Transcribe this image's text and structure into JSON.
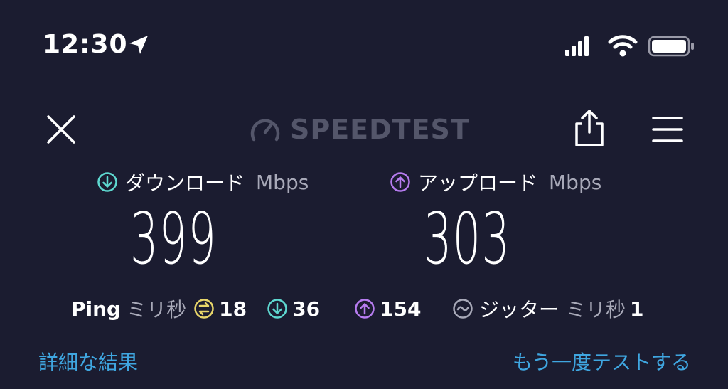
{
  "status_bar": {
    "time": "12:30"
  },
  "header": {
    "logo_text": "SPEEDTEST"
  },
  "download": {
    "label": "ダウンロード",
    "unit": "Mbps",
    "value": "399"
  },
  "upload": {
    "label": "アップロード",
    "unit": "Mbps",
    "value": "303"
  },
  "ping": {
    "label": "Ping",
    "unit": "ミリ秒",
    "idle": "18",
    "download": "36",
    "upload": "154"
  },
  "jitter": {
    "label": "ジッター",
    "unit": "ミリ秒",
    "value": "1"
  },
  "footer": {
    "details_link": "詳細な結果",
    "retest_link": "もう一度テストする"
  },
  "colors": {
    "background": "#1b1c30",
    "download_accent": "#5ed8d0",
    "upload_accent": "#b77cf0",
    "ping_idle_accent": "#e8d66a",
    "link": "#3fa6e0",
    "muted_text": "#a8a9b8"
  },
  "icons": {
    "location": "location-arrow-icon",
    "signal": "cellular-signal-icon",
    "wifi": "wifi-icon",
    "battery": "battery-icon",
    "close": "close-icon",
    "share": "share-icon",
    "menu": "hamburger-menu-icon",
    "download": "download-arrow-icon",
    "upload": "upload-arrow-icon",
    "idle": "idle-ping-icon",
    "jitter": "jitter-wave-icon"
  }
}
